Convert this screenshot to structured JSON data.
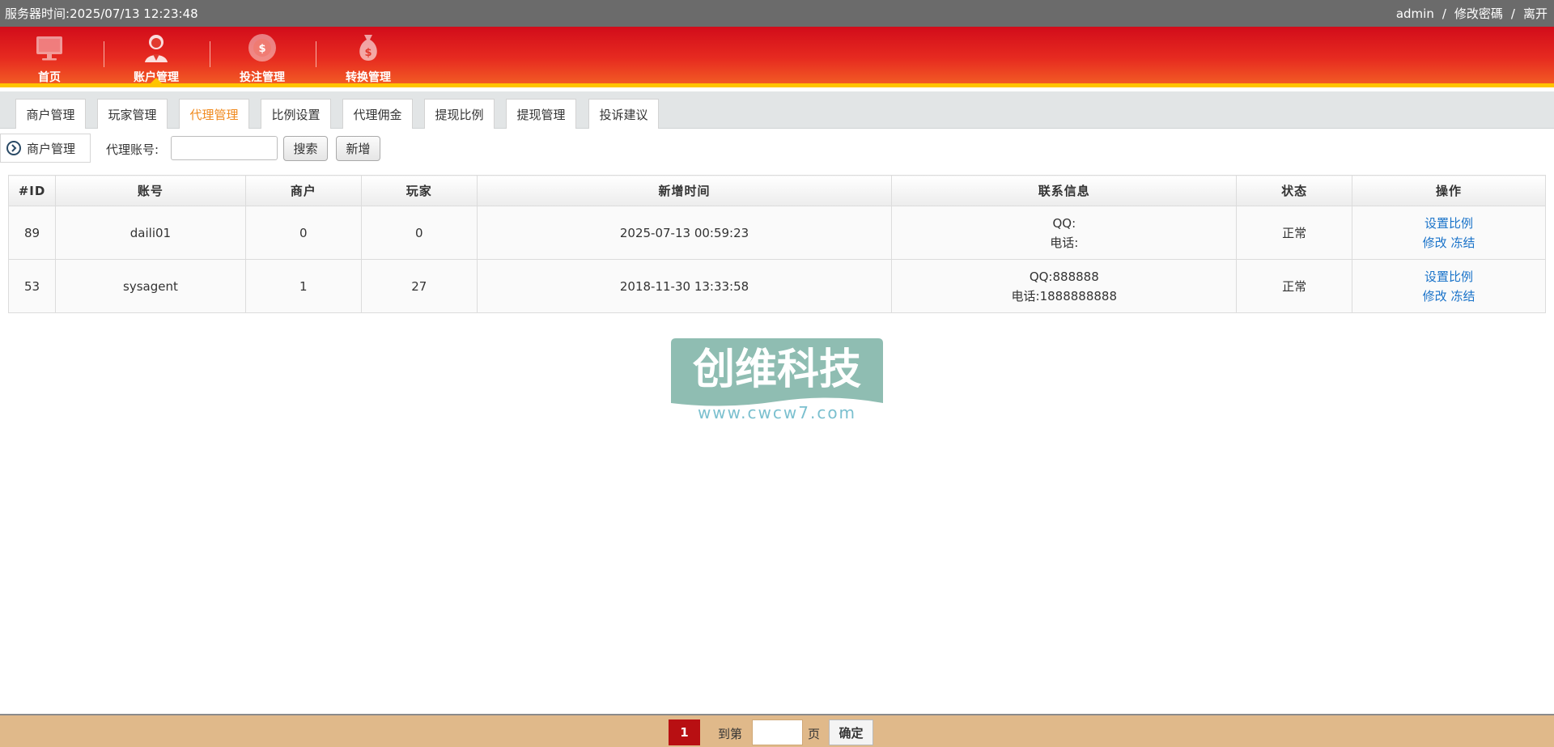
{
  "topbar": {
    "server_time_label": "服务器时间:",
    "server_time": "2025/07/13 12:23:48",
    "user": "admin",
    "change_password": "修改密碼",
    "logout": "离开",
    "separator": "/"
  },
  "nav": {
    "items": [
      {
        "label": "首页",
        "icon": "monitor-icon"
      },
      {
        "label": "账户管理",
        "icon": "user-icon"
      },
      {
        "label": "投注管理",
        "icon": "chip-icon"
      },
      {
        "label": "转换管理",
        "icon": "money-bag-icon"
      }
    ],
    "active_index": 1
  },
  "subtabs": [
    {
      "label": "商户管理"
    },
    {
      "label": "玩家管理"
    },
    {
      "label": "代理管理"
    },
    {
      "label": "比例设置"
    },
    {
      "label": "代理佣金"
    },
    {
      "label": "提现比例"
    },
    {
      "label": "提现管理"
    },
    {
      "label": "投诉建议"
    }
  ],
  "active_subtab": 2,
  "toolbar": {
    "breadcrumb": "商户管理",
    "filter_label": "代理账号:",
    "filter_value": "",
    "search_button": "搜索",
    "add_button": "新增"
  },
  "table": {
    "headers": [
      "#ID",
      "账号",
      "商户",
      "玩家",
      "新增时间",
      "联系信息",
      "状态",
      "操作"
    ],
    "rows": [
      {
        "id": "89",
        "account": "daili01",
        "merchants": "0",
        "players": "0",
        "created": "2025-07-13 00:59:23",
        "qq": "QQ:",
        "phone": "电话:",
        "status": "正常",
        "action_ratio": "设置比例",
        "action_edit": "修改",
        "action_freeze": "冻结"
      },
      {
        "id": "53",
        "account": "sysagent",
        "merchants": "1",
        "players": "27",
        "created": "2018-11-30 13:33:58",
        "qq": "QQ:888888",
        "phone": "电话:1888888888",
        "status": "正常",
        "action_ratio": "设置比例",
        "action_edit": "修改",
        "action_freeze": "冻结"
      }
    ]
  },
  "watermark": {
    "title": "创维科技",
    "url": "www.cwcw7.com"
  },
  "pagination": {
    "current_page": "1",
    "goto_label": "到第",
    "goto_value": "",
    "page_suffix": "页",
    "confirm_button": "确定"
  },
  "colors": {
    "nav_red": "#d20c1a",
    "nav_accent": "#ffc400",
    "active_tab": "#f08a1e",
    "link": "#1a73c9",
    "footer": "#e0b98a",
    "page_current": "#b80f12"
  }
}
